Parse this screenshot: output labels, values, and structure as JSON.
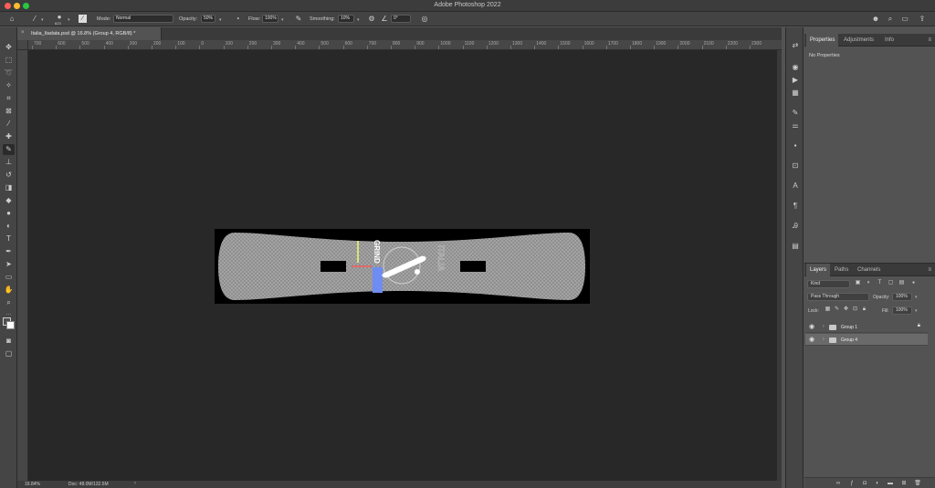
{
  "app": {
    "title": "Adobe Photoshop 2022",
    "traffic_colors": [
      "#ff5f57",
      "#febc2e",
      "#28c840"
    ]
  },
  "options_bar": {
    "brush_size": "623",
    "mode_label": "Mode:",
    "mode_value": "Normal",
    "opacity_label": "Opacity:",
    "opacity_value": "50%",
    "flow_label": "Flow:",
    "flow_value": "100%",
    "smoothing_label": "Smoothing:",
    "smoothing_value": "10%",
    "angle_value": "0°"
  },
  "document": {
    "tab_title": "Italia_Itadata.psd @ 16.8% (Group 4, RGB/8) *",
    "close_glyph": "×"
  },
  "ruler": {
    "labels": [
      "700",
      "600",
      "500",
      "400",
      "300",
      "200",
      "100",
      "0",
      "100",
      "200",
      "300",
      "400",
      "500",
      "600",
      "700",
      "800",
      "900",
      "1000",
      "1100",
      "1200",
      "1300",
      "1400",
      "1500",
      "1600",
      "1700",
      "1800",
      "1900",
      "2000",
      "2100",
      "2200",
      "2300"
    ]
  },
  "status": {
    "zoom": "16.84%",
    "doc": "Doc: 48.0M/132.5M",
    "arrow": "›"
  },
  "artwork": {
    "brand_text": "GRIND",
    "vertical_text": "ITALIA",
    "board_color": "#9a9a9a",
    "accent_blue": "#6f8cf2",
    "accent_yellow": "#d9e37a",
    "accent_red": "#e06a6a"
  },
  "properties_panel": {
    "tabs": [
      "Properties",
      "Adjustments",
      "Info"
    ],
    "active_tab": "Properties",
    "empty_text": "No Properties"
  },
  "layers_panel": {
    "tabs": [
      "Layers",
      "Paths",
      "Channels"
    ],
    "active_tab": "Layers",
    "filter_kind": "Kind",
    "blend_mode": "Pass Through",
    "opacity_label": "Opacity:",
    "opacity_value": "100%",
    "lock_label": "Lock:",
    "fill_label": "Fill:",
    "fill_value": "100%",
    "layers": [
      {
        "name": "Group 1",
        "locked": true,
        "selected": false
      },
      {
        "name": "Group 4",
        "locked": false,
        "selected": true
      }
    ]
  },
  "icons": {
    "menu": "≡"
  }
}
